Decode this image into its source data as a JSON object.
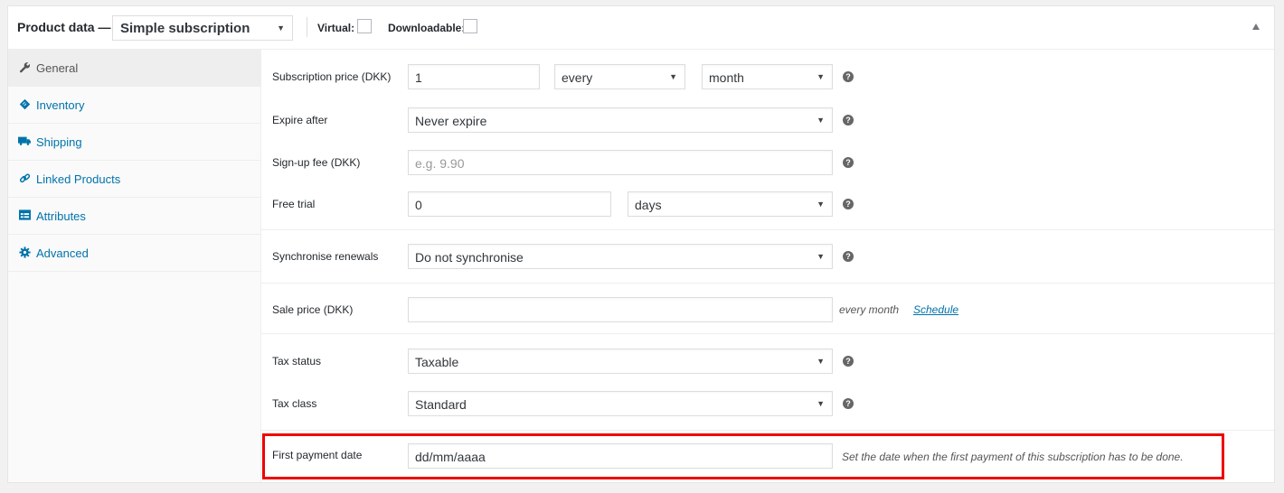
{
  "header": {
    "title": "Product data —",
    "product_type": "Simple subscription",
    "virtual_label": "Virtual:",
    "virtual_checked": false,
    "downloadable_label": "Downloadable:",
    "downloadable_checked": false,
    "collapse_icon": "triangle-up-icon"
  },
  "sidebar": {
    "items": [
      {
        "label": "General",
        "icon": "wrench-icon",
        "active": true
      },
      {
        "label": "Inventory",
        "icon": "tag-icon",
        "active": false
      },
      {
        "label": "Shipping",
        "icon": "truck-icon",
        "active": false
      },
      {
        "label": "Linked Products",
        "icon": "link-icon",
        "active": false
      },
      {
        "label": "Attributes",
        "icon": "list-card-icon",
        "active": false
      },
      {
        "label": "Advanced",
        "icon": "gear-icon",
        "active": false
      }
    ]
  },
  "fields": {
    "subscription_price": {
      "label": "Subscription price (DKK)",
      "value": "1",
      "interval": "every",
      "period": "month"
    },
    "expire_after": {
      "label": "Expire after",
      "value": "Never expire"
    },
    "signup_fee": {
      "label": "Sign-up fee (DKK)",
      "placeholder": "e.g. 9.90",
      "value": ""
    },
    "free_trial": {
      "label": "Free trial",
      "value": "0",
      "period": "days"
    },
    "synchronise": {
      "label": "Synchronise renewals",
      "value": "Do not synchronise"
    },
    "sale_price": {
      "label": "Sale price (DKK)",
      "value": "",
      "suffix": "every month",
      "schedule_link": "Schedule"
    },
    "tax_status": {
      "label": "Tax status",
      "value": "Taxable"
    },
    "tax_class": {
      "label": "Tax class",
      "value": "Standard"
    },
    "first_payment": {
      "label": "First payment date",
      "value": "dd/mm/aaaa",
      "description": "Set the date when the first payment of this subscription has to be done."
    }
  },
  "help_icon_glyph": "?",
  "select_arrow_glyph": "▼",
  "colors": {
    "accent": "#0073aa",
    "highlight_border": "#ee0000"
  }
}
